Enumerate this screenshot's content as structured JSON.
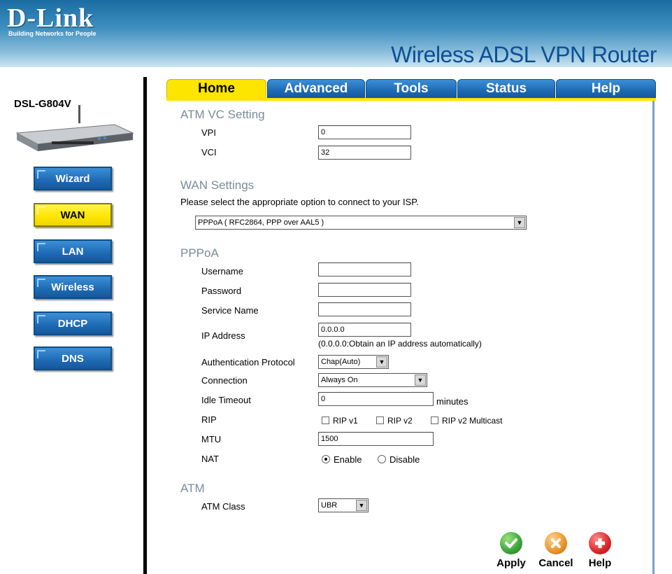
{
  "header": {
    "brand": "D-Link",
    "tagline": "Building Networks for People",
    "product_title": "Wireless ADSL VPN Router"
  },
  "sidebar": {
    "model": "DSL-G804V",
    "items": [
      {
        "label": "Wizard"
      },
      {
        "label": "WAN",
        "active": true
      },
      {
        "label": "LAN"
      },
      {
        "label": "Wireless"
      },
      {
        "label": "DHCP"
      },
      {
        "label": "DNS"
      }
    ]
  },
  "tabs": [
    {
      "label": "Home",
      "active": true
    },
    {
      "label": "Advanced"
    },
    {
      "label": "Tools"
    },
    {
      "label": "Status"
    },
    {
      "label": "Help"
    }
  ],
  "atm_vc": {
    "title": "ATM VC Setting",
    "vpi_label": "VPI",
    "vpi_value": "0",
    "vci_label": "VCI",
    "vci_value": "32"
  },
  "wan": {
    "title": "WAN Settings",
    "instruction": "Please select the appropriate option to connect to your ISP.",
    "connection_type": "PPPoA ( RFC2864, PPP over AAL5 )"
  },
  "pppoa": {
    "title": "PPPoA",
    "username_label": "Username",
    "username_value": "",
    "password_label": "Password",
    "password_value": "",
    "service_name_label": "Service Name",
    "service_name_value": "",
    "ip_label": "IP Address",
    "ip_value": "0.0.0.0",
    "ip_hint": "(0.0.0.0:Obtain an IP address automatically)",
    "auth_label": "Authentication Protocol",
    "auth_value": "Chap(Auto)",
    "connection_label": "Connection",
    "connection_value": "Always On",
    "idle_label": "Idle Timeout",
    "idle_value": "0",
    "idle_unit": "minutes",
    "rip_label": "RIP",
    "rip_options": [
      "RIP v1",
      "RIP v2",
      "RIP v2 Multicast"
    ],
    "mtu_label": "MTU",
    "mtu_value": "1500",
    "nat_label": "NAT",
    "nat_options": [
      "Enable",
      "Disable"
    ],
    "nat_selected": "Enable"
  },
  "atm": {
    "title": "ATM",
    "class_label": "ATM Class",
    "class_value": "UBR"
  },
  "actions": {
    "apply": "Apply",
    "cancel": "Cancel",
    "help": "Help"
  },
  "colors": {
    "accent_blue": "#1e6ab4",
    "active_yellow": "#fde500",
    "section_gray": "#7a8b9a",
    "apply_green": "#3aa33a",
    "cancel_orange": "#e8932a",
    "help_red": "#d9262a"
  },
  "icons": {
    "apply": "checkmark-icon",
    "cancel": "x-icon",
    "help": "plus-icon"
  }
}
